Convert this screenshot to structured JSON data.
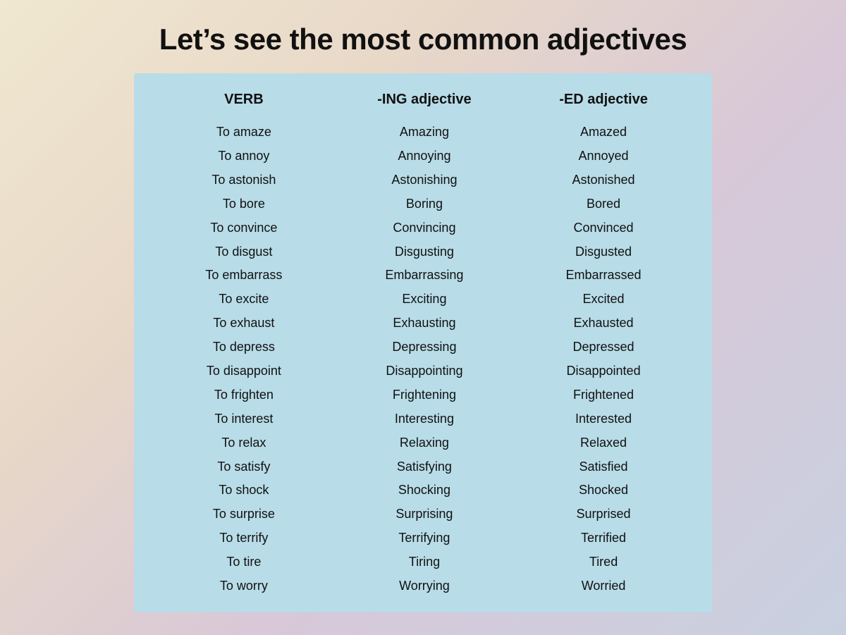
{
  "title": "Let’s see the most common adjectives",
  "table": {
    "headers": [
      "VERB",
      "-ING adjective",
      "-ED adjective"
    ],
    "rows": [
      [
        "To amaze",
        "Amazing",
        "Amazed"
      ],
      [
        "To annoy",
        "Annoying",
        "Annoyed"
      ],
      [
        "To astonish",
        "Astonishing",
        "Astonished"
      ],
      [
        "To bore",
        "Boring",
        "Bored"
      ],
      [
        "To convince",
        "Convincing",
        "Convinced"
      ],
      [
        "To disgust",
        "Disgusting",
        "Disgusted"
      ],
      [
        "To embarrass",
        "Embarrassing",
        "Embarrassed"
      ],
      [
        "To excite",
        "Exciting",
        "Excited"
      ],
      [
        "To exhaust",
        "Exhausting",
        "Exhausted"
      ],
      [
        "To depress",
        "Depressing",
        "Depressed"
      ],
      [
        "To disappoint",
        "Disappointing",
        "Disappointed"
      ],
      [
        "To frighten",
        "Frightening",
        "Frightened"
      ],
      [
        "To interest",
        "Interesting",
        "Interested"
      ],
      [
        "To relax",
        "Relaxing",
        "Relaxed"
      ],
      [
        "To satisfy",
        "Satisfying",
        "Satisfied"
      ],
      [
        "To shock",
        "Shocking",
        "Shocked"
      ],
      [
        "To surprise",
        "Surprising",
        "Surprised"
      ],
      [
        "To terrify",
        "Terrifying",
        "Terrified"
      ],
      [
        "To tire",
        "Tiring",
        "Tired"
      ],
      [
        "To worry",
        "Worrying",
        "Worried"
      ]
    ]
  }
}
